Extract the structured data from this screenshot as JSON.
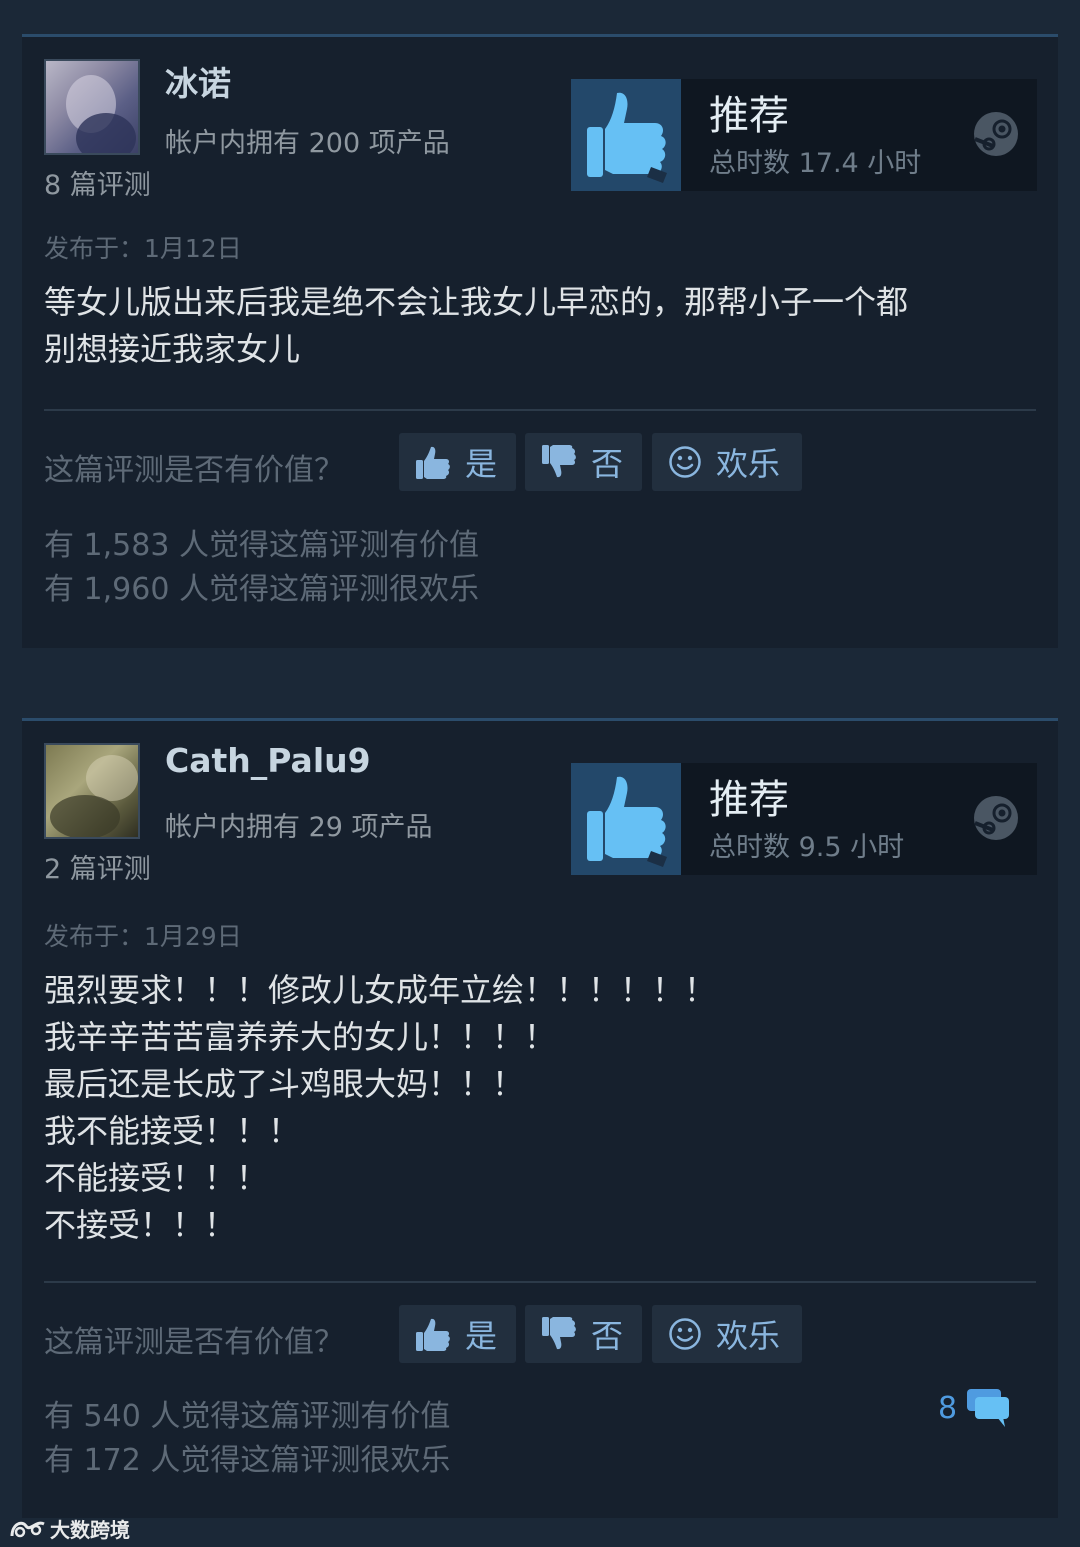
{
  "reviews": [
    {
      "username": "冰诺",
      "products_owned": "帐户内拥有 200 项产品",
      "review_count": "8 篇评测",
      "verdict": "推荐",
      "hours": "总时数 17.4 小时",
      "posted": "发布于：1月12日",
      "content": [
        "等女儿版出来后我是绝不会让我女儿早恋的，那帮小子一个都",
        "别想接近我家女儿"
      ],
      "helpful_question": "这篇评测是否有价值？",
      "yes_label": "是",
      "no_label": "否",
      "funny_label": "欢乐",
      "helpful_stat": "有 1,583 人觉得这篇评测有价值",
      "funny_stat": "有 1,960 人觉得这篇评测很欢乐"
    },
    {
      "username": "Cath_Palu9",
      "products_owned": "帐户内拥有 29 项产品",
      "review_count": "2 篇评测",
      "verdict": "推荐",
      "hours": "总时数 9.5 小时",
      "posted": "发布于：1月29日",
      "content": [
        "强烈要求！！！修改儿女成年立绘！！！！！！",
        "我辛辛苦苦富养养大的女儿！！！！",
        "最后还是长成了斗鸡眼大妈！！！",
        "我不能接受！！！",
        "不能接受！！！",
        "不接受！！！"
      ],
      "helpful_question": "这篇评测是否有价值？",
      "yes_label": "是",
      "no_label": "否",
      "funny_label": "欢乐",
      "helpful_stat": "有 540 人觉得这篇评测有价值",
      "funny_stat": "有 172 人觉得这篇评测很欢乐",
      "comment_count": "8"
    }
  ],
  "watermark": "大数跨境",
  "colors": {
    "page_bg": "#1b2837",
    "card_bg": "#16202d",
    "accent_border": "#2b4c6b",
    "thumb_bg": "#23486a",
    "thumb_icon": "#66c0f4",
    "button_text": "#8ab6df",
    "muted_text": "#5e6a77"
  },
  "icons": [
    "thumbs-up-icon",
    "thumbs-down-icon",
    "smiley-icon",
    "steam-logo-icon",
    "comment-bubble-icon"
  ]
}
